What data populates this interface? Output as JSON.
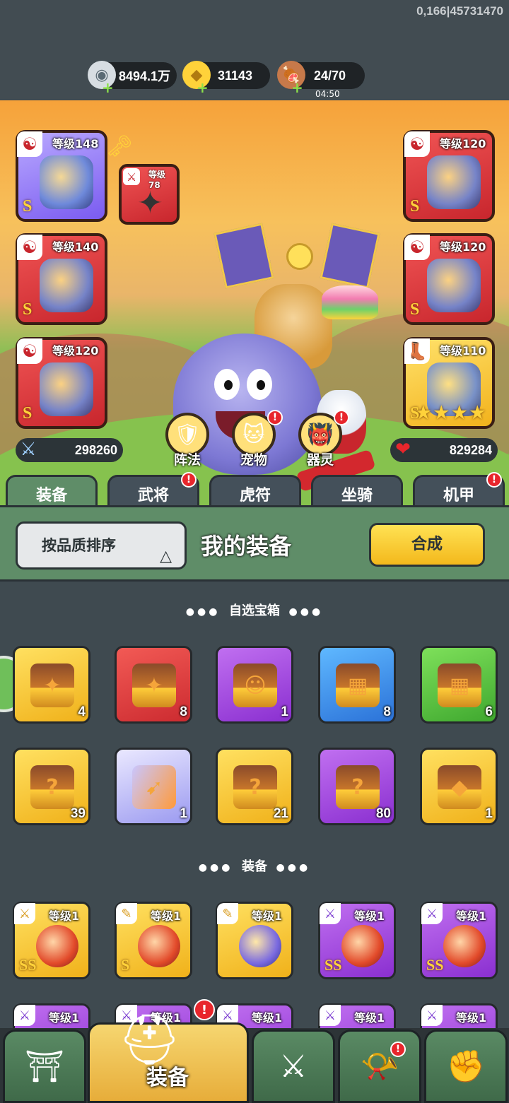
{
  "top": {
    "id_text": "0,166|45731470",
    "silver": "8494.1万",
    "gold": "31143",
    "stamina": "24/70",
    "stamina_timer": "04:50"
  },
  "equip_slots": {
    "weapon": {
      "level": "等级148",
      "grade": "S"
    },
    "small": {
      "level": "等级78"
    },
    "left2": {
      "level": "等级140",
      "grade": "S"
    },
    "left3": {
      "level": "等级120",
      "grade": "S"
    },
    "right1": {
      "level": "等级120",
      "grade": "S"
    },
    "right2": {
      "level": "等级120",
      "grade": "S"
    },
    "right3": {
      "level": "等级110",
      "grade": "S"
    }
  },
  "stats": {
    "attack": "298260",
    "hp": "829284"
  },
  "sub_buttons": [
    {
      "label": "阵法"
    },
    {
      "label": "宠物"
    },
    {
      "label": "器灵"
    }
  ],
  "tabs": [
    {
      "label": "装备"
    },
    {
      "label": "武将"
    },
    {
      "label": "虎符"
    },
    {
      "label": "坐骑"
    },
    {
      "label": "机甲"
    }
  ],
  "panel": {
    "sort_label": "按品质排序",
    "title": "我的装备",
    "combine_label": "合成"
  },
  "sections": {
    "chests": "自选宝箱",
    "equipment": "装备"
  },
  "chest_items": [
    {
      "count": "4",
      "color": "gold"
    },
    {
      "count": "8",
      "color": "red"
    },
    {
      "count": "1",
      "color": "purple"
    },
    {
      "count": "8",
      "color": "blue"
    },
    {
      "count": "6",
      "color": "green"
    },
    {
      "count": "39",
      "color": "gold"
    },
    {
      "count": "1",
      "color": "lightblue"
    },
    {
      "count": "21",
      "color": "gold"
    },
    {
      "count": "80",
      "color": "purple"
    },
    {
      "count": "1",
      "color": "gold"
    }
  ],
  "equip_items": [
    {
      "level": "等级1",
      "grade": "SS",
      "color": "gold"
    },
    {
      "level": "等级1",
      "grade": "S",
      "color": "gold"
    },
    {
      "level": "等级1",
      "grade": "",
      "color": "gold"
    },
    {
      "level": "等级1",
      "grade": "SS",
      "color": "purple"
    },
    {
      "level": "等级1",
      "grade": "SS",
      "color": "purple"
    }
  ],
  "equip_items_row2": [
    {
      "level": "等级1"
    },
    {
      "level": "等级1"
    },
    {
      "level": "等级1"
    },
    {
      "level": "等级1"
    },
    {
      "level": "等级1"
    }
  ],
  "nav": {
    "active_label": "装备"
  },
  "alert_mark": "!"
}
